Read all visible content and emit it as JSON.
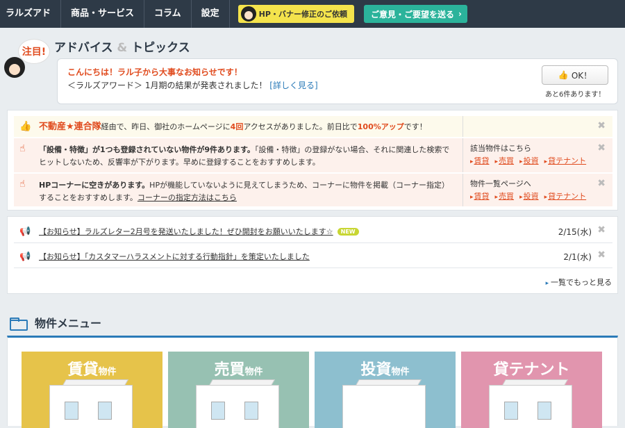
{
  "nav": {
    "items": [
      "ラルズアド",
      "商品・サービス",
      "コラム",
      "設定"
    ],
    "request_label": "HP・バナー修正のご依頼",
    "feedback_label": "ご意見・ご要望を送る"
  },
  "advice": {
    "bubble": "注目!",
    "title_a": "アドバイス",
    "title_amp": "&",
    "title_b": "トピックス",
    "greeting": "こんにちは！ラル子から大事なお知らせです！",
    "message": "＜ラルズアワード＞ 1月期の結果が発表されました！",
    "message_link": "[詳しく見る]",
    "ok_label": "OK！",
    "remaining": "あと6件あります！"
  },
  "notices": [
    {
      "brand": "不動産★連合隊",
      "t1": "経由で、昨日、御社のホームページに",
      "count": "4回",
      "t2": "アクセスがありました。前日比で",
      "pct": "100%アップ",
      "t3": "です！"
    },
    {
      "bold": "「設備・特徴」が1つも登録されていない物件が9件あります。",
      "rest": "「設備・特徴」の登録がない場合、それに関連した検索でヒットしないため、反響率が下がります。早めに登録することをおすすめします。",
      "side_title": "該当物件はこちら",
      "links": [
        "賃貸",
        "売買",
        "投資",
        "貸テナント"
      ]
    },
    {
      "bold": "HPコーナーに空きがあります。",
      "rest": "HPが機能していないように見えてしまうため、コーナーに物件を掲載（コーナー指定）することをおすすめします。",
      "link": "コーナーの指定方法はこちら",
      "side_title": "物件一覧ページへ",
      "links": [
        "賃貸",
        "売買",
        "投資",
        "貸テナント"
      ]
    }
  ],
  "news": {
    "items": [
      {
        "title": "【お知らせ】ラルズレター2月号を発送いたしました！ぜひ開封をお願いいたします☆",
        "badge": "NEW",
        "date": "2/15(水)"
      },
      {
        "title": "【お知らせ】「カスタマーハラスメントに対する行動指針」を策定いたしました",
        "date": "2/1(水)"
      }
    ],
    "more": "一覧でもっと見る"
  },
  "menu": {
    "title": "物件メニュー",
    "cards": [
      {
        "label": "賃貸",
        "suffix": "物件",
        "color": "#e6c34a"
      },
      {
        "label": "売買",
        "suffix": "物件",
        "color": "#97c1b2"
      },
      {
        "label": "投資",
        "suffix": "物件",
        "color": "#8dbfcf"
      },
      {
        "label": "貸テナント",
        "suffix": "",
        "color": "#e195ae"
      }
    ]
  }
}
